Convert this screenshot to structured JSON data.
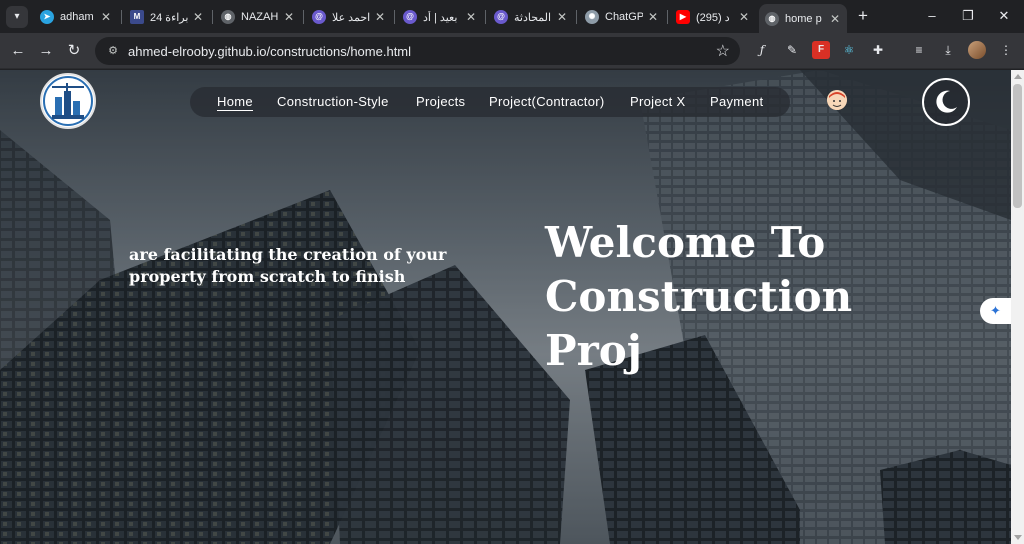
{
  "browser": {
    "tabs": [
      {
        "label": "adham",
        "favicon": "telegram-icon",
        "color": "#2aa3e0"
      },
      {
        "label": "براءة 24",
        "favicon": "m-logo-icon",
        "color": "#3b4a8c"
      },
      {
        "label": "NAZAH",
        "favicon": "globe-icon",
        "color": "#5f6368"
      },
      {
        "label": "احمد علا",
        "favicon": "chat-bot-icon",
        "color": "#6a5acd"
      },
      {
        "label": "بعيد | أد",
        "favicon": "chat-bot-icon",
        "color": "#6a5acd"
      },
      {
        "label": "المحادثة",
        "favicon": "chat-bot-icon",
        "color": "#6a5acd"
      },
      {
        "label": "ChatGP",
        "favicon": "chatgpt-icon",
        "color": "#8e9ca8"
      },
      {
        "label": "(295) د",
        "favicon": "youtube-icon",
        "color": "#ff0000"
      },
      {
        "label": "home p",
        "favicon": "globe-icon",
        "color": "#5f6368"
      }
    ],
    "url": "ahmed-elrooby.github.io/constructions/home.html",
    "close_glyph": "✕",
    "new_tab_glyph": "+"
  },
  "page": {
    "nav": [
      {
        "label": "Home",
        "active": true
      },
      {
        "label": "Construction-Style"
      },
      {
        "label": "Projects"
      },
      {
        "label": "Project(Contractor)"
      },
      {
        "label": "Project X"
      },
      {
        "label": "Payment"
      }
    ],
    "tagline": "are facilitating the creation of your property from scratch to finish",
    "hero_title": "Welcome To Construction Proj",
    "theme_icon": "moon-icon"
  }
}
